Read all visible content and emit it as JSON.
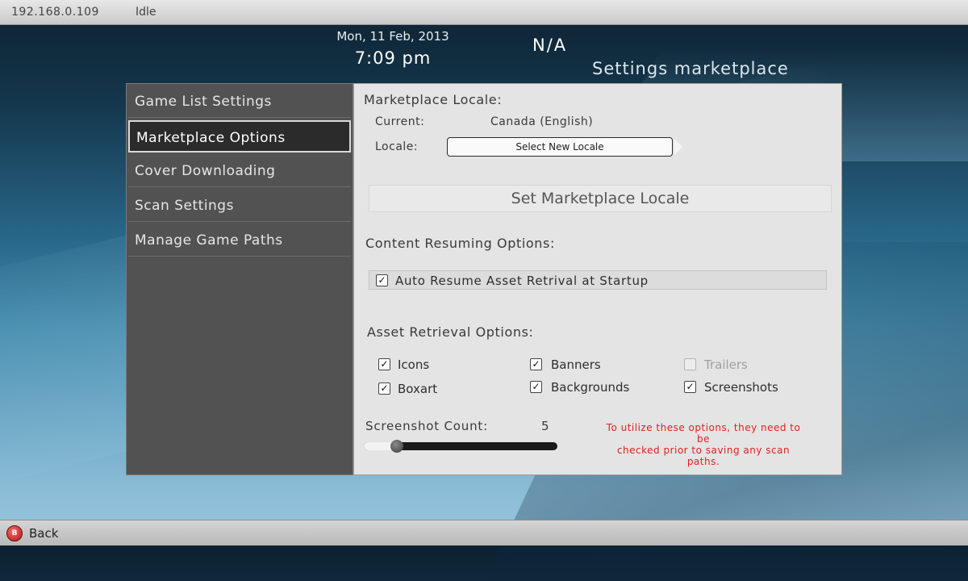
{
  "statusbar": {
    "ip": "192.168.0.109",
    "status": "Idle"
  },
  "header": {
    "date": "Mon, 11 Feb, 2013",
    "time": "7:09 pm",
    "na": "N/A",
    "title": "Settings marketplace"
  },
  "sidebar": {
    "items": [
      {
        "label": "Game List Settings"
      },
      {
        "label": "Marketplace Options"
      },
      {
        "label": "Cover Downloading"
      },
      {
        "label": "Scan Settings"
      },
      {
        "label": "Manage Game Paths"
      }
    ],
    "selected": "Marketplace Options"
  },
  "marketplace": {
    "section_title": "Marketplace Locale:",
    "current_label": "Current:",
    "current_value": "Canada (English)",
    "locale_label": "Locale:",
    "select_button": "Select New Locale",
    "set_button": "Set Marketplace Locale"
  },
  "resuming": {
    "section_title": "Content Resuming Options:",
    "auto_resume_label": "Auto Resume Asset Retrival at Startup",
    "auto_resume_checked": true
  },
  "retrieval": {
    "section_title": "Asset Retrieval Options:",
    "options": [
      {
        "label": "Icons",
        "checked": true
      },
      {
        "label": "Banners",
        "checked": true
      },
      {
        "label": "Trailers",
        "checked": false
      },
      {
        "label": "Boxart",
        "checked": true
      },
      {
        "label": "Backgrounds",
        "checked": true
      },
      {
        "label": "Screenshots",
        "checked": true
      }
    ]
  },
  "screenshots": {
    "count_label": "Screenshot Count:",
    "count_value": "5",
    "slider_fraction": 0.17
  },
  "warning": {
    "line1": "To utilize these options, they need to",
    "line2": "be",
    "line3": "checked prior to saving any scan",
    "line4": "paths."
  },
  "footer": {
    "button_glyph": "B",
    "back_label": "Back"
  },
  "colors": {
    "warning": "#e41e1e",
    "b_button": "#c42020"
  }
}
